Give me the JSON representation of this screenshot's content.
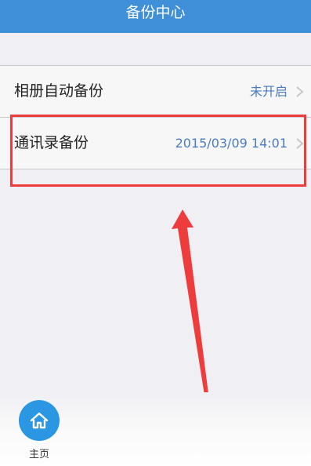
{
  "nav": {
    "title": "备份中心"
  },
  "settings": [
    {
      "label": "相册自动备份",
      "value": "未开启"
    },
    {
      "label": "通讯录备份",
      "value": "2015/03/09 14:01"
    }
  ],
  "tab_bar": {
    "home_label": "主页",
    "home_icon": "home-icon"
  },
  "annotation": {
    "color": "#ee3b3b"
  },
  "colors": {
    "nav": "#3f8fd9",
    "value_text": "#4a7cc1",
    "home_button": "#2b97e3"
  }
}
